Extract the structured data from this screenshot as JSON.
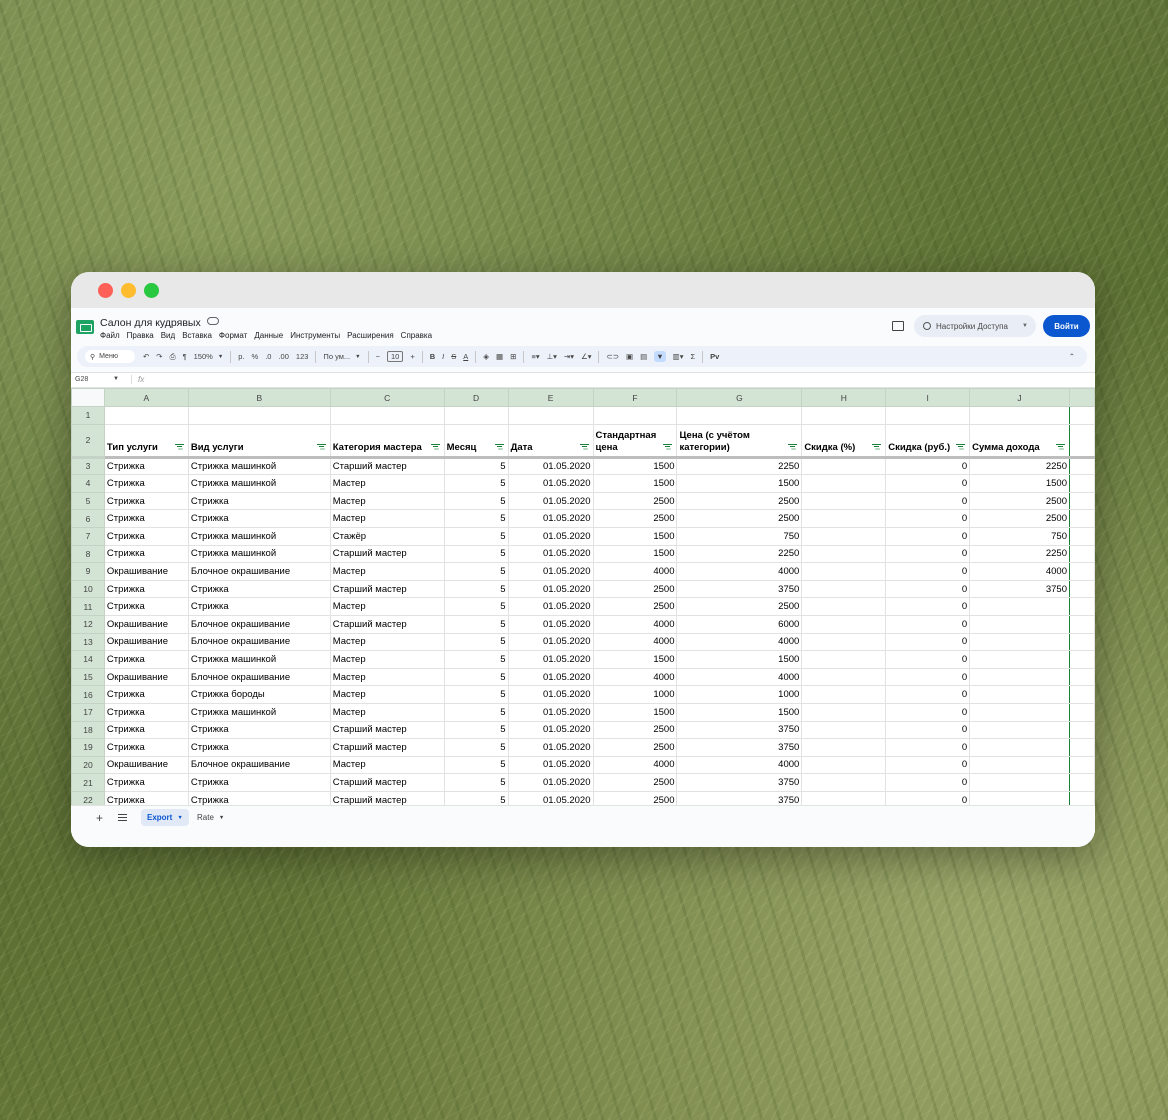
{
  "doc_title": "Салон для кудрявых",
  "menu": [
    "Файл",
    "Правка",
    "Вид",
    "Вставка",
    "Формат",
    "Данные",
    "Инструменты",
    "Расширения",
    "Справка"
  ],
  "share_label": "Настройки Доступа",
  "login_label": "Войти",
  "toolbar": {
    "search": "Меню",
    "zoom": "150%",
    "currency": "р.",
    "percent": "%",
    "dec_less": ".0",
    ".00": ".00",
    "format123": "123",
    "font": "По ум...",
    "font_size": "10",
    "bold": "B",
    "italic": "I",
    "strike": "S",
    "underline_color": "A",
    "sigma": "Σ",
    "input_tools": "Рv"
  },
  "name_box": "G28",
  "fx_label": "fx",
  "columns": [
    "A",
    "B",
    "C",
    "D",
    "E",
    "F",
    "G",
    "H",
    "I",
    "J"
  ],
  "headers": [
    "Тип услуги",
    "Вид услуги",
    "Категория мастера",
    "Месяц",
    "Дата",
    "Стандартная цена",
    "Цена (с учётом категории)",
    "Скидка (%)",
    "Скидка (руб.)",
    "Сумма дохода"
  ],
  "rows": [
    {
      "n": "3",
      "c": [
        "Стрижка",
        "Стрижка машинкой",
        "Старший мастер",
        "5",
        "01.05.2020",
        "1500",
        "2250",
        "",
        "0",
        "2250"
      ]
    },
    {
      "n": "4",
      "c": [
        "Стрижка",
        "Стрижка машинкой",
        "Мастер",
        "5",
        "01.05.2020",
        "1500",
        "1500",
        "",
        "0",
        "1500"
      ]
    },
    {
      "n": "5",
      "c": [
        "Стрижка",
        "Стрижка",
        "Мастер",
        "5",
        "01.05.2020",
        "2500",
        "2500",
        "",
        "0",
        "2500"
      ]
    },
    {
      "n": "6",
      "c": [
        "Стрижка",
        "Стрижка",
        "Мастер",
        "5",
        "01.05.2020",
        "2500",
        "2500",
        "",
        "0",
        "2500"
      ]
    },
    {
      "n": "7",
      "c": [
        "Стрижка",
        "Стрижка машинкой",
        "Стажёр",
        "5",
        "01.05.2020",
        "1500",
        "750",
        "",
        "0",
        "750"
      ]
    },
    {
      "n": "8",
      "c": [
        "Стрижка",
        "Стрижка машинкой",
        "Старший мастер",
        "5",
        "01.05.2020",
        "1500",
        "2250",
        "",
        "0",
        "2250"
      ]
    },
    {
      "n": "9",
      "c": [
        "Окрашивание",
        "Блочное окрашивание",
        "Мастер",
        "5",
        "01.05.2020",
        "4000",
        "4000",
        "",
        "0",
        "4000"
      ]
    },
    {
      "n": "10",
      "c": [
        "Стрижка",
        "Стрижка",
        "Старший мастер",
        "5",
        "01.05.2020",
        "2500",
        "3750",
        "",
        "0",
        "3750"
      ]
    },
    {
      "n": "11",
      "c": [
        "Стрижка",
        "Стрижка",
        "Мастер",
        "5",
        "01.05.2020",
        "2500",
        "2500",
        "",
        "0",
        ""
      ]
    },
    {
      "n": "12",
      "c": [
        "Окрашивание",
        "Блочное окрашивание",
        "Старший мастер",
        "5",
        "01.05.2020",
        "4000",
        "6000",
        "",
        "0",
        ""
      ]
    },
    {
      "n": "13",
      "c": [
        "Окрашивание",
        "Блочное окрашивание",
        "Мастер",
        "5",
        "01.05.2020",
        "4000",
        "4000",
        "",
        "0",
        ""
      ]
    },
    {
      "n": "14",
      "c": [
        "Стрижка",
        "Стрижка машинкой",
        "Мастер",
        "5",
        "01.05.2020",
        "1500",
        "1500",
        "",
        "0",
        ""
      ]
    },
    {
      "n": "15",
      "c": [
        "Окрашивание",
        "Блочное окрашивание",
        "Мастер",
        "5",
        "01.05.2020",
        "4000",
        "4000",
        "",
        "0",
        ""
      ]
    },
    {
      "n": "16",
      "c": [
        "Стрижка",
        "Стрижка бороды",
        "Мастер",
        "5",
        "01.05.2020",
        "1000",
        "1000",
        "",
        "0",
        ""
      ]
    },
    {
      "n": "17",
      "c": [
        "Стрижка",
        "Стрижка машинкой",
        "Мастер",
        "5",
        "01.05.2020",
        "1500",
        "1500",
        "",
        "0",
        ""
      ]
    },
    {
      "n": "18",
      "c": [
        "Стрижка",
        "Стрижка",
        "Старший мастер",
        "5",
        "01.05.2020",
        "2500",
        "3750",
        "",
        "0",
        ""
      ]
    },
    {
      "n": "19",
      "c": [
        "Стрижка",
        "Стрижка",
        "Старший мастер",
        "5",
        "01.05.2020",
        "2500",
        "3750",
        "",
        "0",
        ""
      ]
    },
    {
      "n": "20",
      "c": [
        "Окрашивание",
        "Блочное окрашивание",
        "Мастер",
        "5",
        "01.05.2020",
        "4000",
        "4000",
        "",
        "0",
        ""
      ]
    },
    {
      "n": "21",
      "c": [
        "Стрижка",
        "Стрижка",
        "Старший мастер",
        "5",
        "01.05.2020",
        "2500",
        "3750",
        "",
        "0",
        ""
      ]
    },
    {
      "n": "22",
      "c": [
        "Стрижка",
        "Стрижка",
        "Старший мастер",
        "5",
        "01.05.2020",
        "2500",
        "3750",
        "",
        "0",
        ""
      ]
    }
  ],
  "sheets": [
    "Export",
    "Rate"
  ],
  "colors": {
    "accent": "#0b57d0",
    "sheets_green": "#188038",
    "header_fill": "#d3e3d4"
  }
}
